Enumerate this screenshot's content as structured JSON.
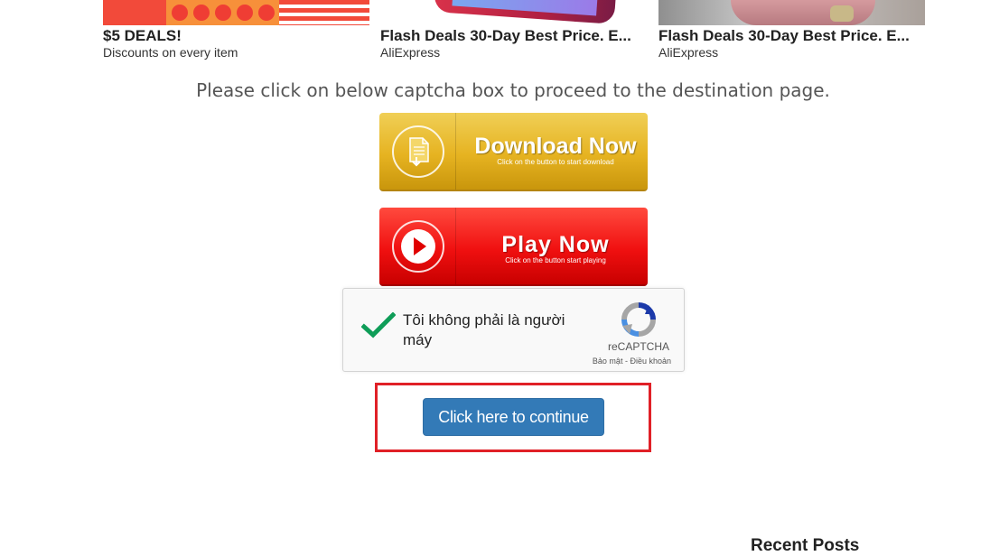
{
  "ads": [
    {
      "title": "$5 DEALS!",
      "subtitle": "Discounts on every item"
    },
    {
      "title": "Flash Deals 30-Day Best Price. E...",
      "subtitle": "AliExpress"
    },
    {
      "title": "Flash Deals 30-Day Best Price. E...",
      "subtitle": "AliExpress"
    }
  ],
  "instruction": "Please click on below captcha box to proceed to the destination page.",
  "download_button": {
    "main": "Download Now",
    "sub": "Click on the button to start download"
  },
  "play_button": {
    "main": "Play Now",
    "sub": "Click on the button start playing"
  },
  "captcha": {
    "label": "Tôi không phải là người máy",
    "brand": "reCAPTCHA",
    "privacy": "Bảo mật",
    "terms": "Điều khoản",
    "checked": true
  },
  "continue_button": "Click here to continue",
  "sidebar": {
    "recent_posts_heading": "Recent Posts"
  },
  "colors": {
    "continue": "#337ab7",
    "highlight": "#e02027",
    "check": "#0f9d58"
  }
}
